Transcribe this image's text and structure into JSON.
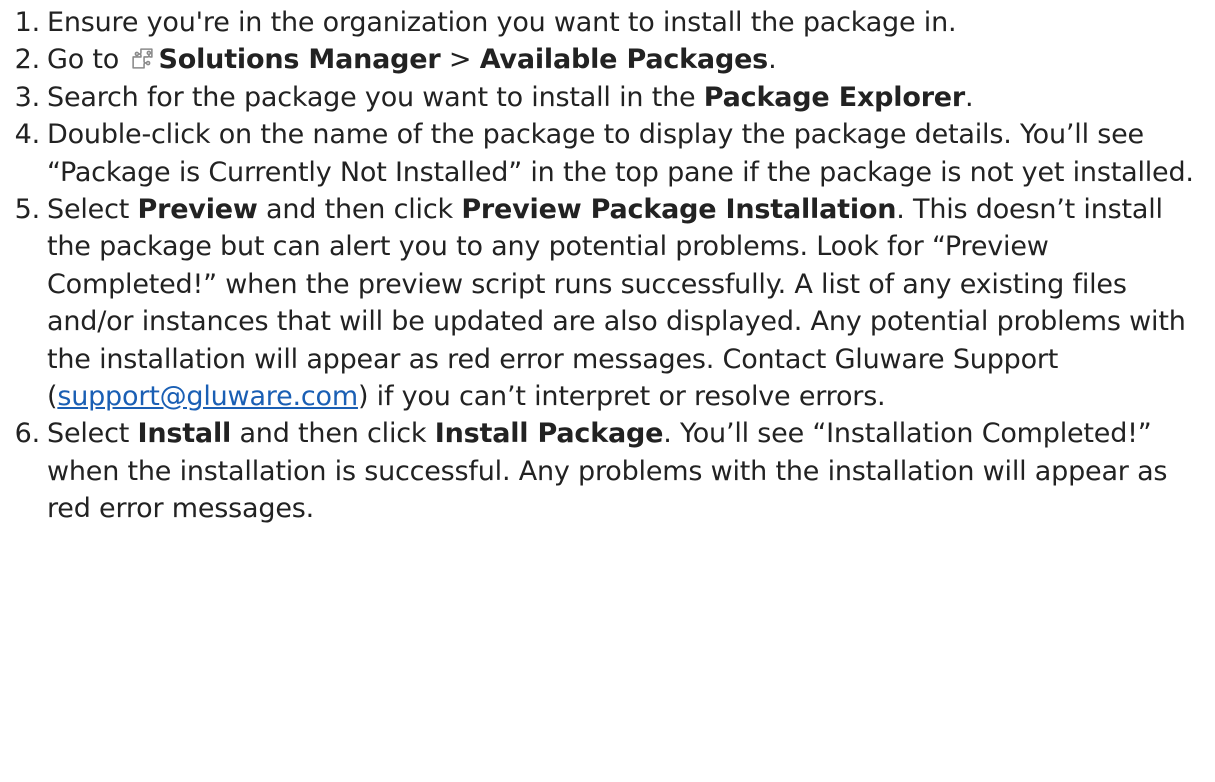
{
  "steps": [
    {
      "number": "1.",
      "parts": {
        "t1": "Ensure you're in the organization you want to install the package in."
      }
    },
    {
      "number": "2.",
      "parts": {
        "t1": "Go to",
        "b1": "Solutions Manager",
        "t2": " > ",
        "b2": "Available Packages",
        "t3": "."
      },
      "icon": "puzzle-piece-icon"
    },
    {
      "number": "3.",
      "parts": {
        "t1": "Search for the package you want to install in the ",
        "b1": "Package Explorer",
        "t2": "."
      }
    },
    {
      "number": "4.",
      "parts": {
        "t1": "Double-click on the name of the package to display the package details. You’ll see “Package is Currently Not Installed” in the top pane if the package is not yet installed."
      }
    },
    {
      "number": "5.",
      "parts": {
        "t1": "Select ",
        "b1": "Preview",
        "t2": " and then click ",
        "b2": "Preview Package Installation",
        "t3": ". This doesn’t install the package but can alert you to any potential problems. Look for “Preview Completed!” when the preview script runs successfully. A list of any existing files and/or instances that will be updated are also displayed. Any potential problems with the installation will appear as red error messages. Contact Gluware Support (",
        "link": "support@gluware.com",
        "t4": ") if you can’t interpret or resolve errors."
      }
    },
    {
      "number": "6.",
      "parts": {
        "t1": "Select ",
        "b1": "Install",
        "t2": " and then click ",
        "b2": "Install Package",
        "t3": ". You’ll see “Installation Completed!” when the installation is successful. Any problems with the installation will appear as red error messages."
      }
    }
  ],
  "colors": {
    "text": "#222222",
    "link": "#1a5fb4",
    "icon_stroke": "#8a8a8a"
  }
}
